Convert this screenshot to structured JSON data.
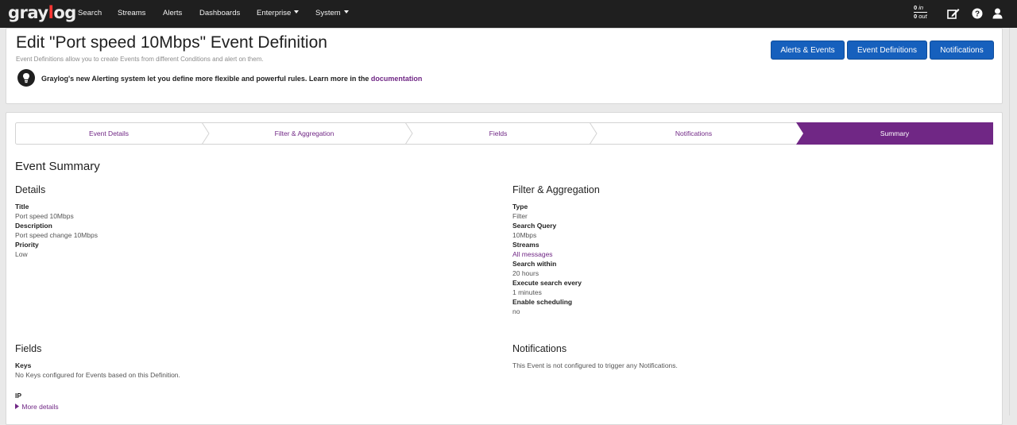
{
  "navbar": {
    "logo": {
      "gray": "gray",
      "o": "l",
      "rest": "og"
    },
    "items": [
      {
        "label": "Search"
      },
      {
        "label": "Streams"
      },
      {
        "label": "Alerts"
      },
      {
        "label": "Dashboards"
      },
      {
        "label": "Enterprise"
      },
      {
        "label": "System"
      }
    ],
    "throughput": {
      "in_value": "0",
      "in_unit": "in",
      "out_value": "0",
      "out_unit": "out"
    },
    "icons": [
      "edit-icon",
      "help-icon",
      "user-icon"
    ]
  },
  "header": {
    "title": "Edit \"Port speed 10Mbps\" Event Definition",
    "subtitle": "Event Definitions allow you to create Events from different Conditions and alert on them.",
    "hint_text": "Graylog's new Alerting system let you define more flexible and powerful rules. Learn more in the ",
    "hint_link": "documentation",
    "buttons": {
      "alerts_events": "Alerts & Events",
      "event_definitions": "Event Definitions",
      "notifications": "Notifications"
    }
  },
  "wizard": {
    "steps": [
      {
        "label": "Event Details"
      },
      {
        "label": "Filter & Aggregation"
      },
      {
        "label": "Fields"
      },
      {
        "label": "Notifications"
      },
      {
        "label": "Summary"
      }
    ],
    "active_step": "Summary"
  },
  "summary": {
    "heading": "Event Summary",
    "details": {
      "heading": "Details",
      "title_label": "Title",
      "title_value": "Port speed 10Mbps",
      "description_label": "Description",
      "description_value": "Port speed change 10Mbps",
      "priority_label": "Priority",
      "priority_value": "Low"
    },
    "filter": {
      "heading": "Filter & Aggregation",
      "type_label": "Type",
      "type_value": "Filter",
      "query_label": "Search Query",
      "query_value": "10Mbps",
      "streams_label": "Streams",
      "streams_value": "All messages",
      "within_label": "Search within",
      "within_value": "20 hours",
      "every_label": "Execute search every",
      "every_value": "1 minutes",
      "scheduling_label": "Enable scheduling",
      "scheduling_value": "no"
    },
    "fields": {
      "heading": "Fields",
      "keys_label": "Keys",
      "keys_value": "No Keys configured for Events based on this Definition.",
      "field_name": "IP",
      "more_details": "More details"
    },
    "notifications": {
      "heading": "Notifications",
      "text": "This Event is not configured to trigger any Notifications."
    }
  },
  "colors": {
    "navbar": "#1f1f1f",
    "primary_button": "#1660bd",
    "accent_purple": "#702785",
    "logo_red": "#ff3633"
  }
}
